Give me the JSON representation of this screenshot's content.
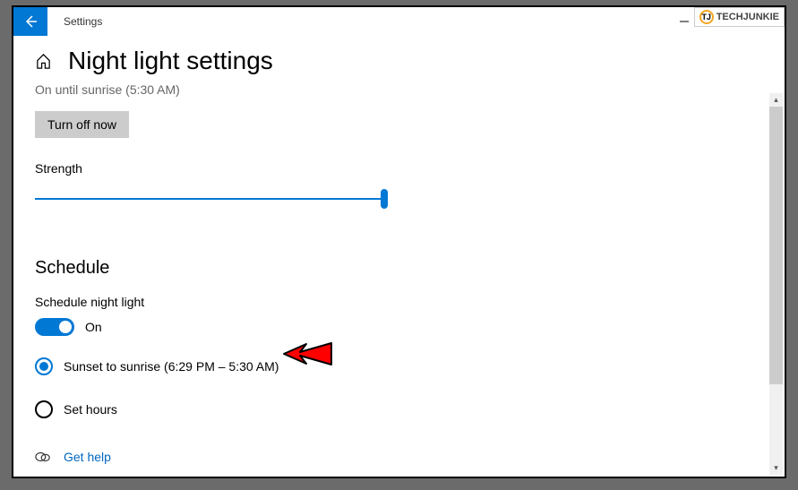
{
  "watermark": {
    "text": "TECHJUNKIE",
    "icon_text": "TJ"
  },
  "titlebar": {
    "app_name": "Settings"
  },
  "page": {
    "title": "Night light settings",
    "truncated_status": "On until sunrise (5:30 AM)",
    "turn_off_label": "Turn off now",
    "strength_label": "Strength"
  },
  "schedule": {
    "section_title": "Schedule",
    "toggle_label": "Schedule night light",
    "toggle_state": "On",
    "option_sunset": "Sunset to sunrise (6:29 PM – 5:30 AM)",
    "option_set_hours": "Set hours"
  },
  "help": {
    "link_text": "Get help"
  }
}
